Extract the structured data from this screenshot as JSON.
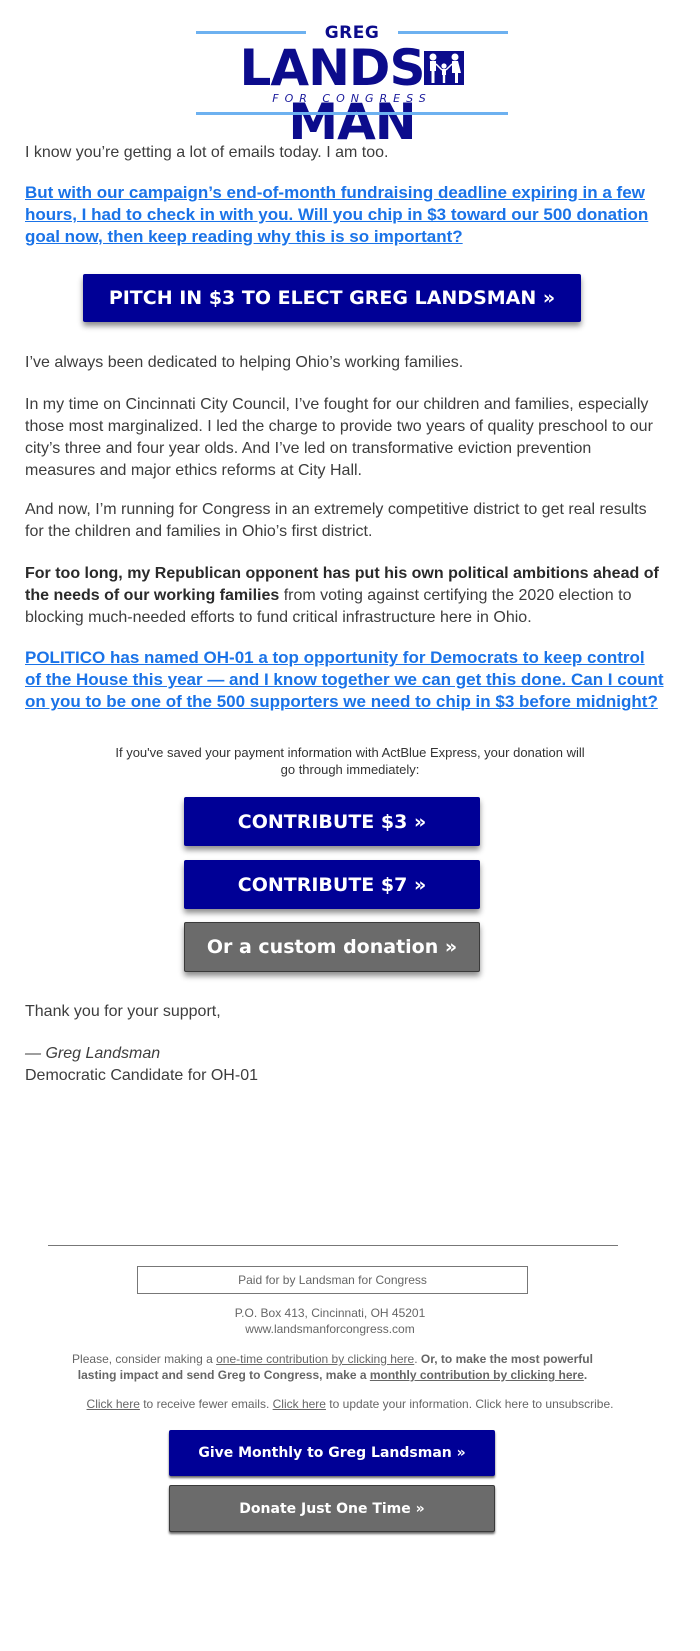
{
  "logo": {
    "first_name": "GREG",
    "last_name_start": "LANDS",
    "last_name_end": "MAN",
    "tagline": "FOR CONGRESS",
    "icon": "family-icon"
  },
  "colors": {
    "brand_navy": "#000096",
    "link_blue": "#1a73e8",
    "logo_rule_blue": "#6db1f0",
    "button_gray": "#6b6b6b"
  },
  "body": {
    "intro": "I know you’re getting a lot of emails today. I am too.",
    "ask_link": "But with our campaign’s end-of-month fundraising deadline expiring in a few hours, I had to check in with you. Will you chip in $3 toward our 500 donation goal now, then keep reading why this is so important?",
    "main_button": "PITCH IN $3 TO ELECT GREG LANDSMAN »",
    "para1": "I’ve always been dedicated to helping Ohio’s working families.",
    "para2": "In my time on Cincinnati City Council, I’ve fought for our children and families, especially those most marginalized. I led the charge to provide two years of quality preschool to our city’s three and four year olds. And I’ve led on transformative eviction prevention measures and major ethics reforms at City Hall.",
    "para3": "And now, I’m running for Congress in an extremely competitive district to get real results for the children and families in Ohio’s first district.",
    "para4_bold": "For too long, my Republican opponent has put his own political ambitions ahead of the needs of our working families",
    "para4_rest": " from voting against certifying the 2020 election to blocking much-needed efforts to fund critical infrastructure here in Ohio.",
    "politico_link": "POLITICO has named OH-01 a top opportunity for Democrats to keep control of the House this year — and I know together we can get this done. Can I count on you to be one of the 500 supporters we need to chip in $3 before midnight?",
    "express_note": "If you've saved your payment information with ActBlue Express, your donation will go through immediately:",
    "buttons": {
      "contribute_3": "CONTRIBUTE $3 »",
      "contribute_7": "CONTRIBUTE $7 »",
      "custom": "Or a custom donation »"
    },
    "thanks": "Thank you for your support,",
    "signature_name": "— Greg Landsman",
    "signature_title": "Democratic Candidate for OH-01"
  },
  "footer": {
    "paid_for": "Paid for by Landsman for Congress",
    "address": "P.O. Box 413, Cincinnati, OH 45201",
    "website": "www.landsmanforcongress.com",
    "consider_pre": "Please, consider making a ",
    "one_time_link": "one-time contribution by clicking here",
    "consider_mid": ". ",
    "bold_text": "Or, to make the most powerful lasting impact and send Greg to Congress, make a ",
    "monthly_link": "monthly contribution by clicking here",
    "bold_end": ".",
    "fewer_link": "Click here",
    "fewer_text": " to receive fewer emails. ",
    "update_link": "Click here",
    "update_text": " to update your information. Click here to unsubscribe.",
    "monthly_button": "Give Monthly to Greg Landsman »",
    "one_time_button": "Donate Just One Time »"
  }
}
